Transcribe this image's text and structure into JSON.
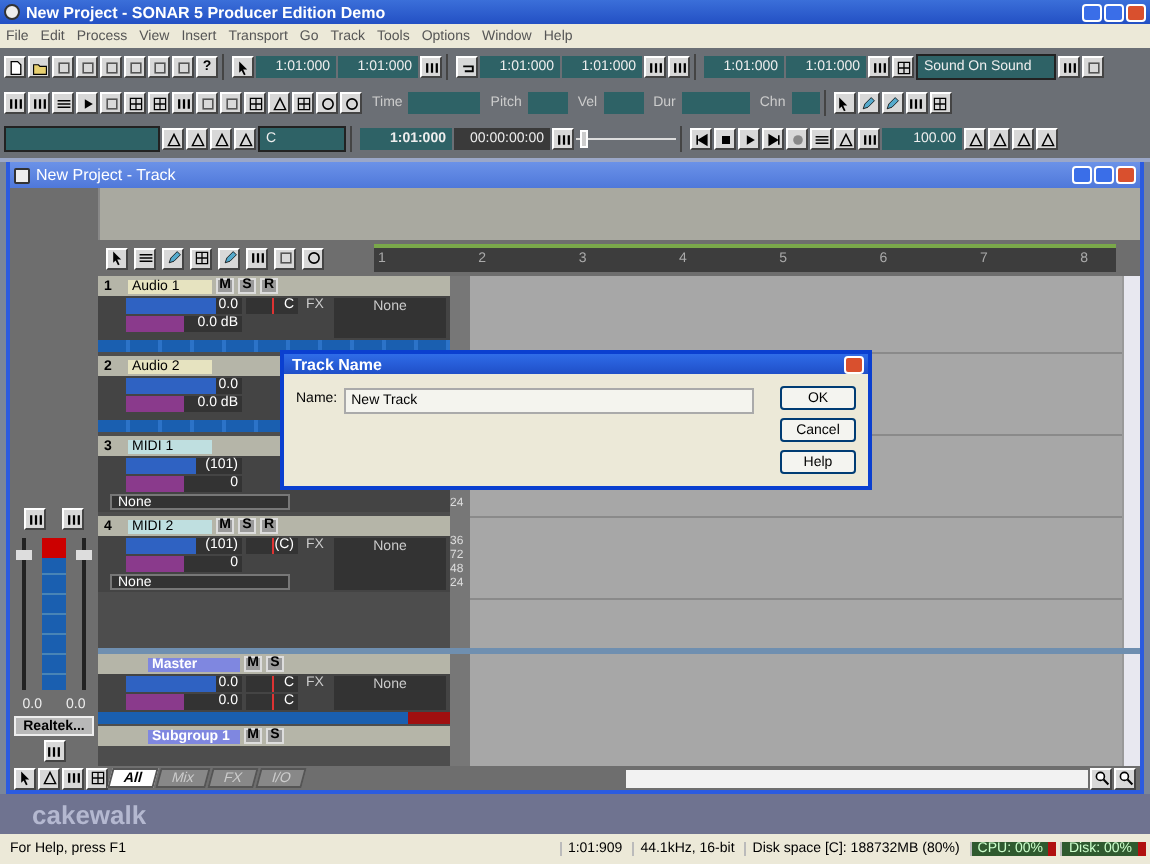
{
  "window": {
    "title": "New Project - SONAR 5 Producer Edition Demo"
  },
  "menu": [
    "File",
    "Edit",
    "Process",
    "View",
    "Insert",
    "Transport",
    "Go",
    "Track",
    "Tools",
    "Options",
    "Window",
    "Help"
  ],
  "toolbar": {
    "help": "?",
    "times": [
      "1:01:000",
      "1:01:000",
      "1:01:000",
      "1:01:000",
      "1:01:000",
      "1:01:000"
    ],
    "record_mode": "Sound On Sound",
    "event_fields": [
      "Time",
      "Pitch",
      "Vel",
      "Dur",
      "Chn"
    ],
    "key": "C",
    "now": "1:01:000",
    "smpte": "00:00:00:00",
    "position": {
      "level": 0.04
    },
    "tempo": "100.00"
  },
  "track_window": {
    "title": "New Project - Track",
    "ruler": [
      "1",
      "2",
      "3",
      "4",
      "5",
      "6",
      "7",
      "8"
    ],
    "tracks": [
      {
        "number": "1",
        "name": "Audio 1",
        "kind": "audio",
        "buttons": [
          "M",
          "S",
          "R"
        ],
        "volume": {
          "text": "0.0",
          "level": 0.78
        },
        "pan": {
          "text": "C",
          "level": 0.5
        },
        "trim": {
          "text": "0.0 dB",
          "level": 0.5
        },
        "fx": "FX",
        "fx_slot": "None"
      },
      {
        "number": "2",
        "name": "Audio 2",
        "kind": "audio",
        "volume": {
          "text": "0.0",
          "level": 0.78
        },
        "trim": {
          "text": "0.0 dB",
          "level": 0.5
        }
      },
      {
        "number": "3",
        "name": "MIDI 1",
        "kind": "midi",
        "volume": {
          "text": "(101)",
          "level": 0.6
        },
        "trim": {
          "text": "0",
          "level": 0.5
        },
        "port": "None",
        "scale": [
          "24"
        ]
      },
      {
        "number": "4",
        "name": "MIDI 2",
        "kind": "midi",
        "buttons": [
          "M",
          "S",
          "R"
        ],
        "volume": {
          "text": "(101)",
          "level": 0.6
        },
        "pan": {
          "text": "(C)",
          "level": 0.5
        },
        "trim": {
          "text": "0",
          "level": 0.5
        },
        "port": "None",
        "fx": "FX",
        "fx_slot": "None",
        "scale": [
          "36",
          "72",
          "48",
          "24"
        ]
      }
    ],
    "buses": [
      {
        "name": "Master",
        "buttons": [
          "M",
          "S"
        ],
        "volume": {
          "text": "0.0",
          "level": 0.78
        },
        "pan": {
          "text": "C",
          "level": 0.5
        },
        "trim": {
          "text": "0.0",
          "level": 0.5
        },
        "pan2": {
          "text": "C",
          "level": 0.5
        },
        "fx": "FX",
        "fx_slot": "None"
      },
      {
        "name": "Subgroup 1",
        "buttons": [
          "M",
          "S"
        ]
      }
    ],
    "strip": {
      "readings": [
        "0.0",
        "0.0"
      ],
      "output": "Realtek..."
    },
    "tabs": [
      {
        "label": "All",
        "selected": true
      },
      {
        "label": "Mix",
        "selected": false
      },
      {
        "label": "FX",
        "selected": false
      },
      {
        "label": "I/O",
        "selected": false
      }
    ]
  },
  "dialog": {
    "title": "Track Name",
    "label": "Name:",
    "value": "New Track",
    "buttons": [
      "OK",
      "Cancel",
      "Help"
    ]
  },
  "logo": "cakewalk",
  "status_bar": {
    "help": "For Help, press F1",
    "time": "1:01:909",
    "format": "44.1kHz, 16-bit",
    "disk_space": "Disk space [C]: 188732MB (80%)",
    "cpu": "CPU: 00%",
    "disk": "Disk: 00%"
  }
}
